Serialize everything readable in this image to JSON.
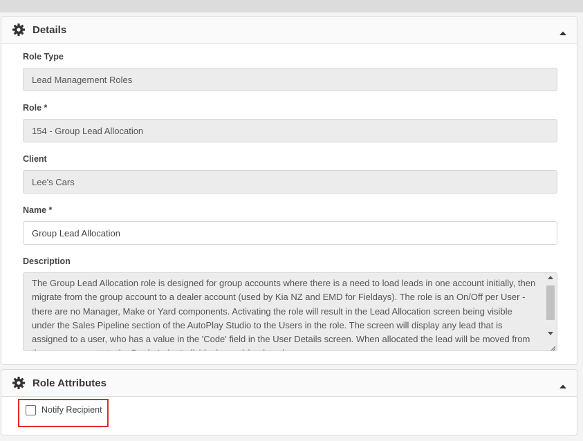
{
  "details": {
    "title": "Details",
    "fields": {
      "role_type": {
        "label": "Role Type",
        "value": "Lead Management Roles"
      },
      "role": {
        "label": "Role *",
        "value": "154 - Group Lead Allocation"
      },
      "client": {
        "label": "Client",
        "value": "Lee's Cars"
      },
      "name": {
        "label": "Name *",
        "value": "Group Lead Allocation"
      },
      "description": {
        "label": "Description",
        "value": "The Group Lead Allocation role is designed for group accounts where there is a need to load leads in one account initially, then migrate from the group account to a dealer account (used by Kia NZ and EMD for Fieldays). The role is an On/Off per User - there are no Manager, Make or Yard components. Activating the role will result in the Lead Allocation screen being visible under the Sales Pipeline section of the AutoPlay Studio to the Users in the role. The screen will display any lead that is assigned to a user, who has a value in the 'Code' field in the User Details screen. When allocated the lead will be moved from the group account to the Dealer's (or Individual users) lead pool."
      }
    }
  },
  "role_attributes": {
    "title": "Role Attributes",
    "notify_recipient": {
      "label": "Notify Recipient",
      "checked": false
    }
  },
  "icons": {
    "panel": "gear-icon",
    "collapse": "caret-up-icon"
  }
}
